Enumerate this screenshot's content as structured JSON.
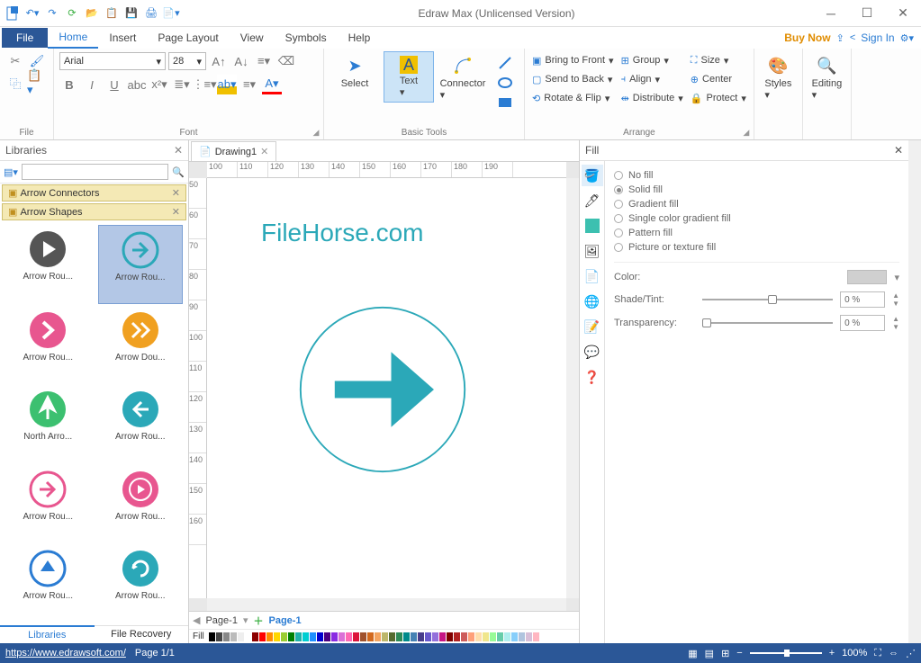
{
  "window": {
    "title": "Edraw Max (Unlicensed Version)"
  },
  "menu": {
    "file": "File",
    "tabs": [
      "Home",
      "Insert",
      "Page Layout",
      "View",
      "Symbols",
      "Help"
    ],
    "active": 0,
    "buy_now": "Buy Now",
    "sign_in": "Sign In"
  },
  "ribbon": {
    "file_group": "File",
    "font_group": "Font",
    "font_name": "Arial",
    "font_size": "28",
    "basic_tools_group": "Basic Tools",
    "select": "Select",
    "text": "Text",
    "connector": "Connector",
    "arrange_group": "Arrange",
    "bring_front": "Bring to Front",
    "send_back": "Send to Back",
    "rotate_flip": "Rotate & Flip",
    "group": "Group",
    "align": "Align",
    "distribute": "Distribute",
    "size": "Size",
    "center": "Center",
    "protect": "Protect",
    "styles": "Styles",
    "editing": "Editing"
  },
  "libraries": {
    "title": "Libraries",
    "search_placeholder": "",
    "categories": [
      "Arrow Connectors",
      "Arrow Shapes"
    ],
    "shapes": [
      {
        "label": "Arrow Rou...",
        "type": "play-dark",
        "color": "#555"
      },
      {
        "label": "Arrow Rou...",
        "type": "arrow-outline",
        "color": "#2ba8b8",
        "selected": true
      },
      {
        "label": "Arrow Rou...",
        "type": "chevron-solid",
        "color": "#e8568f"
      },
      {
        "label": "Arrow Dou...",
        "type": "chevron-double",
        "color": "#f0a020"
      },
      {
        "label": "North Arro...",
        "type": "north-arrow",
        "color": "#3cc070"
      },
      {
        "label": "Arrow Rou...",
        "type": "arrow-left",
        "color": "#2ba8b8"
      },
      {
        "label": "Arrow Rou...",
        "type": "arrow-pink-outline",
        "color": "#e8568f"
      },
      {
        "label": "Arrow Rou...",
        "type": "play-pink",
        "color": "#e8568f"
      },
      {
        "label": "Arrow Rou...",
        "type": "arrow-up-tri",
        "color": "#2b7cd3"
      },
      {
        "label": "Arrow Rou...",
        "type": "refresh",
        "color": "#2ba8b8"
      }
    ],
    "footer_tabs": [
      "Libraries",
      "File Recovery"
    ],
    "footer_active": 0
  },
  "document": {
    "tab_name": "Drawing1",
    "watermark": "FileHorse.com",
    "ruler_h": [
      "100",
      "110",
      "120",
      "130",
      "140",
      "150",
      "160",
      "170",
      "180",
      "190"
    ],
    "ruler_v": [
      "50",
      "60",
      "70",
      "80",
      "90",
      "100",
      "110",
      "120",
      "130",
      "140",
      "150",
      "160"
    ],
    "page_tab_left": "Page-1",
    "page_tab_right": "Page-1",
    "fill_label": "Fill"
  },
  "fill_panel": {
    "title": "Fill",
    "options": [
      "No fill",
      "Solid fill",
      "Gradient fill",
      "Single color gradient fill",
      "Pattern fill",
      "Picture or texture fill"
    ],
    "selected": 1,
    "color_label": "Color:",
    "shade_label": "Shade/Tint:",
    "transparency_label": "Transparency:",
    "shade_value": "0 %",
    "transparency_value": "0 %"
  },
  "status": {
    "url": "https://www.edrawsoft.com/",
    "page_info": "Page 1/1",
    "zoom": "100%"
  }
}
